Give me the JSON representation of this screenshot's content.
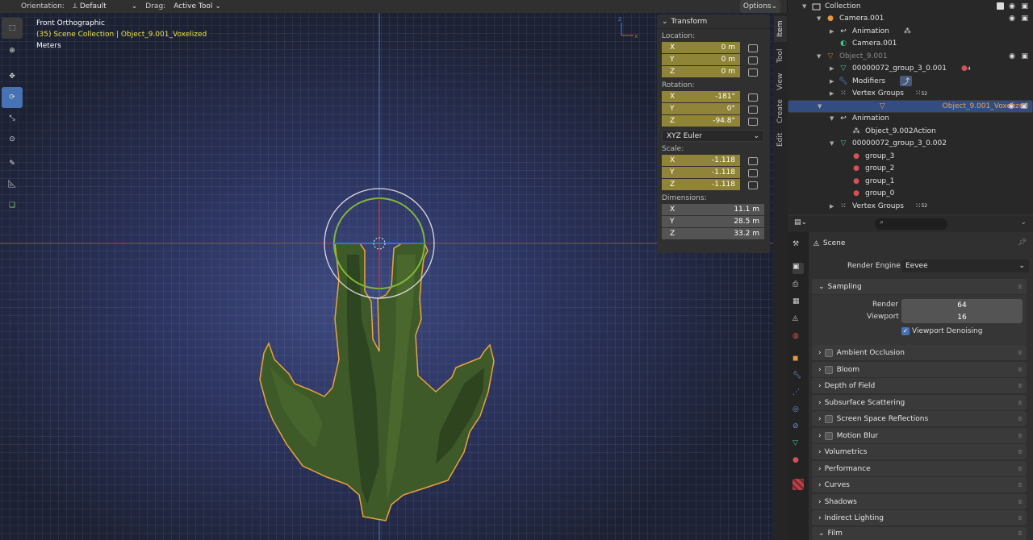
{
  "header": {
    "orientation_label": "Orientation:",
    "orientation_value": "Default",
    "drag_label": "Drag:",
    "drag_value": "Active Tool",
    "options_label": "Options"
  },
  "viewport": {
    "view_name": "Front Orthographic",
    "collection_info": "(35) Scene Collection | Object_9.001_Voxelized",
    "units": "Meters",
    "axis_z": "z",
    "axis_x": "x"
  },
  "npanel": {
    "title": "Transform",
    "location_label": "Location:",
    "location": [
      {
        "axis": "X",
        "value": "0 m"
      },
      {
        "axis": "Y",
        "value": "0 m"
      },
      {
        "axis": "Z",
        "value": "0 m"
      }
    ],
    "rotation_label": "Rotation:",
    "rotation": [
      {
        "axis": "X",
        "value": "-181°"
      },
      {
        "axis": "Y",
        "value": "0°"
      },
      {
        "axis": "Z",
        "value": "-94.8°"
      }
    ],
    "rotation_mode": "XYZ Euler",
    "scale_label": "Scale:",
    "scale": [
      {
        "axis": "X",
        "value": "-1.118"
      },
      {
        "axis": "Y",
        "value": "-1.118"
      },
      {
        "axis": "Z",
        "value": "-1.118"
      }
    ],
    "dimensions_label": "Dimensions:",
    "dimensions": [
      {
        "axis": "X",
        "value": "11.1 m"
      },
      {
        "axis": "Y",
        "value": "28.5 m"
      },
      {
        "axis": "Z",
        "value": "33.2 m"
      }
    ]
  },
  "vtabs": [
    "Item",
    "Tool",
    "View",
    "Create",
    "Edit"
  ],
  "outliner": {
    "rows": [
      {
        "label": "Collection",
        "indent": 1
      },
      {
        "label": "Camera.001",
        "indent": 2
      },
      {
        "label": "Animation",
        "indent": 3
      },
      {
        "label": "Camera.001",
        "indent": 3
      },
      {
        "label": "Object_9.001",
        "indent": 2
      },
      {
        "label": "00000072_group_3_0.001",
        "indent": 3
      },
      {
        "label": "Modifiers",
        "indent": 3
      },
      {
        "label": "Vertex Groups",
        "indent": 3
      },
      {
        "label": "Object_9.001_Voxelized",
        "indent": 2
      },
      {
        "label": "Animation",
        "indent": 3
      },
      {
        "label": "Object_9.002Action",
        "indent": 4
      },
      {
        "label": "00000072_group_3_0.002",
        "indent": 3
      },
      {
        "label": "group_3",
        "indent": 4
      },
      {
        "label": "group_2",
        "indent": 4
      },
      {
        "label": "group_1",
        "indent": 4
      },
      {
        "label": "group_0",
        "indent": 4
      },
      {
        "label": "Vertex Groups",
        "indent": 3
      }
    ],
    "badge_4": "4",
    "badge_52": "52"
  },
  "properties": {
    "scene_label": "Scene",
    "render_engine_label": "Render Engine",
    "render_engine_value": "Eevee",
    "sampling_label": "Sampling",
    "render_label": "Render",
    "render_value": "64",
    "viewport_label": "Viewport",
    "viewport_value": "16",
    "denoise_label": "Viewport Denoising",
    "sections": [
      "Ambient Occlusion",
      "Bloom",
      "Depth of Field",
      "Subsurface Scattering",
      "Screen Space Reflections",
      "Motion Blur",
      "Volumetrics",
      "Performance",
      "Curves",
      "Shadows",
      "Indirect Lighting",
      "Film"
    ]
  },
  "colors": {
    "accent": "#4772b3",
    "field_yellow": "#8f8437",
    "selected_row": "#334d80",
    "outline_orange": "#e8a33c"
  }
}
